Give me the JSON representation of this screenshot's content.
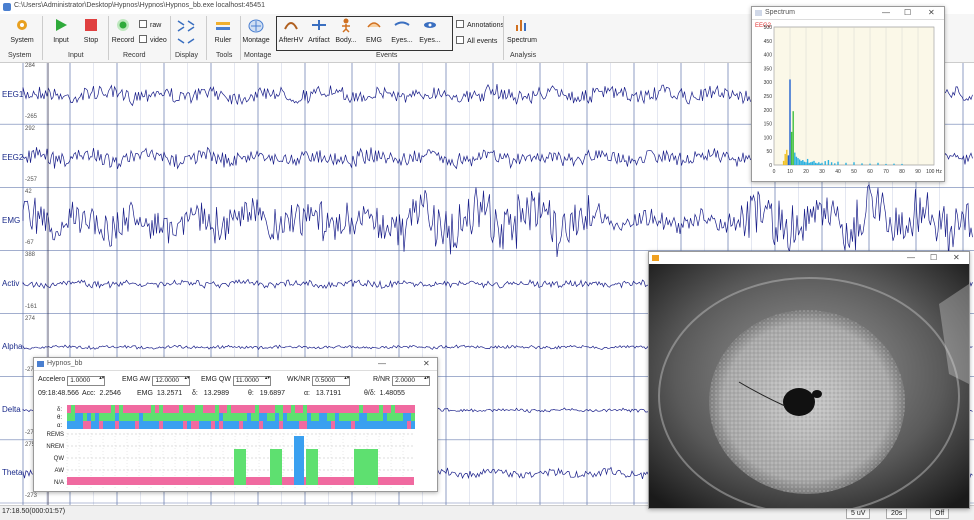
{
  "window": {
    "title": "C:\\Users\\Administrator\\Desktop\\Hypnos\\Hypnos\\Hypnos_bb.exe     localhost:45451"
  },
  "ribbon": {
    "buttons": [
      {
        "id": "system",
        "label": "System",
        "icon": "gear-icon"
      },
      {
        "id": "input",
        "label": "Input",
        "icon": "play-icon"
      },
      {
        "id": "stop",
        "label": "Stop",
        "icon": "stop-icon"
      },
      {
        "id": "record",
        "label": "Record",
        "icon": "record-icon"
      },
      {
        "id": "ruler",
        "label": "Ruler",
        "icon": "ruler-icon"
      },
      {
        "id": "montage",
        "label": "Montage",
        "icon": "montage-icon"
      },
      {
        "id": "afterhv",
        "label": "AfterHV",
        "icon": "event-icon"
      },
      {
        "id": "artifact",
        "label": "Artifact",
        "icon": "event-icon"
      },
      {
        "id": "body",
        "label": "Body...",
        "icon": "event-icon"
      },
      {
        "id": "emg",
        "label": "EMG",
        "icon": "event-icon"
      },
      {
        "id": "eyes1",
        "label": "Eyes...",
        "icon": "event-icon"
      },
      {
        "id": "eyes2",
        "label": "Eyes...",
        "icon": "event-icon"
      },
      {
        "id": "spectrum",
        "label": "Spectrum",
        "icon": "spectrum-icon"
      }
    ],
    "checks": {
      "raw": "raw",
      "video": "video",
      "annotations": "Annotations",
      "all_events": "All events"
    },
    "groups": {
      "system": "System",
      "input": "Input",
      "record": "Record",
      "display": "Display",
      "tools": "Tools",
      "montage": "Montage",
      "events": "Events",
      "analysis": "Analysis"
    }
  },
  "channels": [
    {
      "name": "EEG1",
      "top_scale": "284",
      "bottom_scale": "-265"
    },
    {
      "name": "EEG2",
      "top_scale": "292",
      "bottom_scale": "-257"
    },
    {
      "name": "EMG",
      "top_scale": "42",
      "bottom_scale": "-67"
    },
    {
      "name": "Activ",
      "top_scale": "388",
      "bottom_scale": "-161"
    },
    {
      "name": "Alpha",
      "top_scale": "274",
      "bottom_scale": "-27"
    },
    {
      "name": "Delta",
      "top_scale": "",
      "bottom_scale": "-27"
    },
    {
      "name": "Theta",
      "top_scale": "275",
      "bottom_scale": "-273"
    }
  ],
  "colors": {
    "trace": "#1a1f8a",
    "grid": "#6b7fb0",
    "gridMinor": "#c8cfe3",
    "pink": "#f06aa0",
    "green": "#5ee070",
    "blue": "#3aa0f0"
  },
  "status": {
    "time": "17:18.50(000:01:57)",
    "scale": "5 uV",
    "window": "20s",
    "mode": "Off"
  },
  "spectrum": {
    "title": "Spectrum",
    "channel": "EEG2",
    "xunit": "Hz"
  },
  "chart_data": {
    "type": "bar",
    "x": [
      2,
      3,
      4,
      5,
      6,
      7,
      8,
      9,
      10,
      11,
      12,
      13,
      14,
      15,
      16,
      17,
      18,
      19,
      20,
      21,
      22,
      23,
      24,
      25,
      26,
      27,
      28,
      29,
      30,
      32,
      34,
      36,
      38,
      40,
      45,
      50,
      55,
      60,
      65,
      70,
      75,
      80
    ],
    "values": [
      0,
      0,
      0,
      0,
      15,
      40,
      55,
      35,
      310,
      120,
      195,
      45,
      30,
      25,
      20,
      15,
      18,
      12,
      10,
      22,
      8,
      10,
      12,
      15,
      8,
      6,
      10,
      5,
      8,
      14,
      18,
      10,
      6,
      12,
      8,
      10,
      6,
      5,
      8,
      4,
      5,
      4
    ],
    "xlim": [
      0,
      100
    ],
    "ylim": [
      0,
      500
    ],
    "xticks": [
      "0",
      "10",
      "20",
      "30",
      "40",
      "50",
      "60",
      "70",
      "80",
      "90",
      "100 Hz"
    ],
    "yticks": [
      "500",
      "450",
      "400",
      "350",
      "300",
      "250",
      "200",
      "150",
      "100",
      "50",
      "0"
    ],
    "ylabel": "",
    "xlabel": ""
  },
  "hypno": {
    "title": "Hypnos_bb",
    "accelero_label": "Accelero",
    "accelero": "1.0000",
    "emgaw_label": "EMG AW",
    "emgaw": "12.0000",
    "emgqw_label": "EMG QW",
    "emgqw": "11.0000",
    "wknr_label": "WK/NR",
    "wknr": "0.5000",
    "rnr_label": "R/NR",
    "rnr": "2.0000",
    "time": "09:18:48.566",
    "acc_label": "Acc:",
    "acc": "2.2546",
    "emg_label": "EMG",
    "emg": "13.2571",
    "delta_label": "δ:",
    "delta": "13.2989",
    "theta_label": "θ:",
    "theta": "19.6897",
    "alpha_label": "α:",
    "alpha": "13.7191",
    "ratio_label": "θ/δ:",
    "ratio": "1.48055",
    "band_labels": [
      "δ:",
      "θ:",
      "α:"
    ],
    "states": [
      "REMS",
      "NREM",
      "QW",
      "AW",
      "N/A"
    ]
  }
}
